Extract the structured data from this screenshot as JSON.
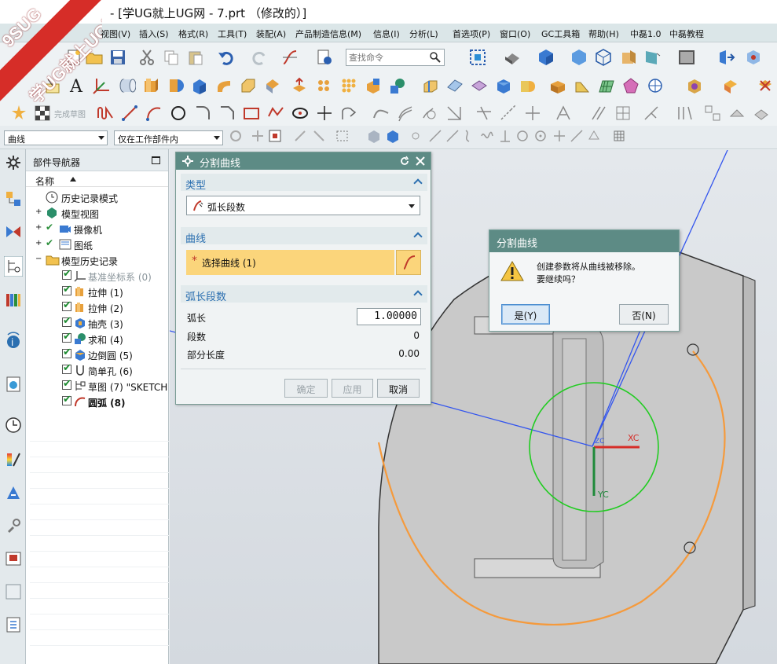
{
  "window": {
    "title": "- [学UG就上UG网 - 7.prt （修改的）]"
  },
  "watermark": {
    "line1": "9SUG",
    "line2": "学UG就上UG网"
  },
  "menu": [
    "视图(V)",
    "插入(S)",
    "格式(R)",
    "工具(T)",
    "装配(A)",
    "产品制造信息(M)",
    "信息(I)",
    "分析(L)",
    "首选项(P)",
    "窗口(O)",
    "GC工具箱",
    "帮助(H)",
    "中磊1.0",
    "中磊教程"
  ],
  "toolbar": {
    "search_placeholder": "查找命令",
    "finish_sketch": "完成草图",
    "curve_filter": "曲线",
    "scope_filter": "仅在工作部件内"
  },
  "navigator": {
    "title": "部件导航器",
    "column_name": "名称",
    "items": [
      {
        "label": "历史记录模式",
        "icon": "clock-icon",
        "level": 1
      },
      {
        "label": "模型视图",
        "icon": "model-view-icon",
        "level": 1
      },
      {
        "label": "摄像机",
        "icon": "camera-icon",
        "level": 1
      },
      {
        "label": "图纸",
        "icon": "drawing-icon",
        "level": 1
      },
      {
        "label": "模型历史记录",
        "icon": "folder-icon",
        "level": 1
      },
      {
        "label": "基准坐标系 (0)",
        "icon": "datum-csys-icon",
        "level": 2
      },
      {
        "label": "拉伸 (1)",
        "icon": "extrude-icon",
        "level": 2
      },
      {
        "label": "拉伸 (2)",
        "icon": "extrude-icon",
        "level": 2
      },
      {
        "label": "抽壳 (3)",
        "icon": "shell-icon",
        "level": 2
      },
      {
        "label": "求和 (4)",
        "icon": "unite-icon",
        "level": 2
      },
      {
        "label": "边倒圆 (5)",
        "icon": "edge-blend-icon",
        "level": 2
      },
      {
        "label": "简单孔 (6)",
        "icon": "hole-icon",
        "level": 2
      },
      {
        "label": "草图 (7) \"SKETCH",
        "icon": "sketch-icon",
        "level": 2
      },
      {
        "label": "圆弧 (8)",
        "icon": "arc-icon",
        "level": 2
      }
    ]
  },
  "dialog": {
    "title": "分割曲线",
    "type_section": "类型",
    "type_value": "弧长段数",
    "curve_section": "曲线",
    "select_curve": "选择曲线 (1)",
    "arc_section": "弧长段数",
    "arc_length_label": "弧长",
    "arc_length_value": "1.00000",
    "segments_label": "段数",
    "segments_value": "0",
    "partial_label": "部分长度",
    "partial_value": "0.00",
    "ok": "确定",
    "apply": "应用",
    "cancel": "取消"
  },
  "message": {
    "title": "分割曲线",
    "line1": "创建参数将从曲线被移除。",
    "line2": "要继续吗？",
    "yes": "是(Y)",
    "no": "否(N)"
  },
  "viewport": {
    "axis_x": "XC",
    "axis_y": "YC",
    "axis_z": "ZC"
  },
  "colors": {
    "dialog_header": "#5d8b85",
    "section_blue": "#2b6fb0",
    "selection": "#fbd57b",
    "orange_arc": "#f59a3c",
    "green_circle": "#22cc22"
  }
}
